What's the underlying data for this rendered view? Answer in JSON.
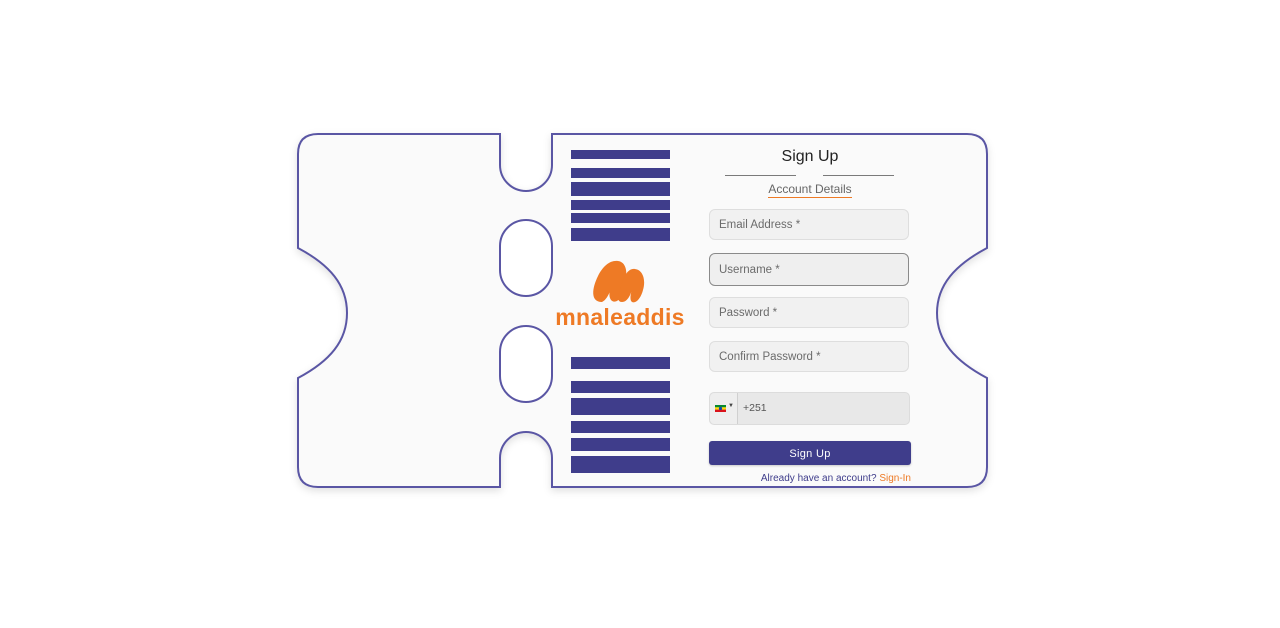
{
  "brand": {
    "name": "mnaleaddis",
    "color": "#ee7a25"
  },
  "theme": {
    "primary": "#3f3d8b",
    "accent": "#ee7a25"
  },
  "form": {
    "title": "Sign Up",
    "step_label": "Account Details",
    "fields": {
      "email_placeholder": "Email Address *",
      "username_placeholder": "Username *",
      "password_placeholder": "Password *",
      "confirm_password_placeholder": "Confirm Password *"
    },
    "phone": {
      "country_flag": "ethiopia-flag-icon",
      "dial_code": "+251"
    },
    "submit_label": "Sign Up",
    "signin_prompt": "Already have an account?",
    "signin_link": "Sign-In"
  }
}
